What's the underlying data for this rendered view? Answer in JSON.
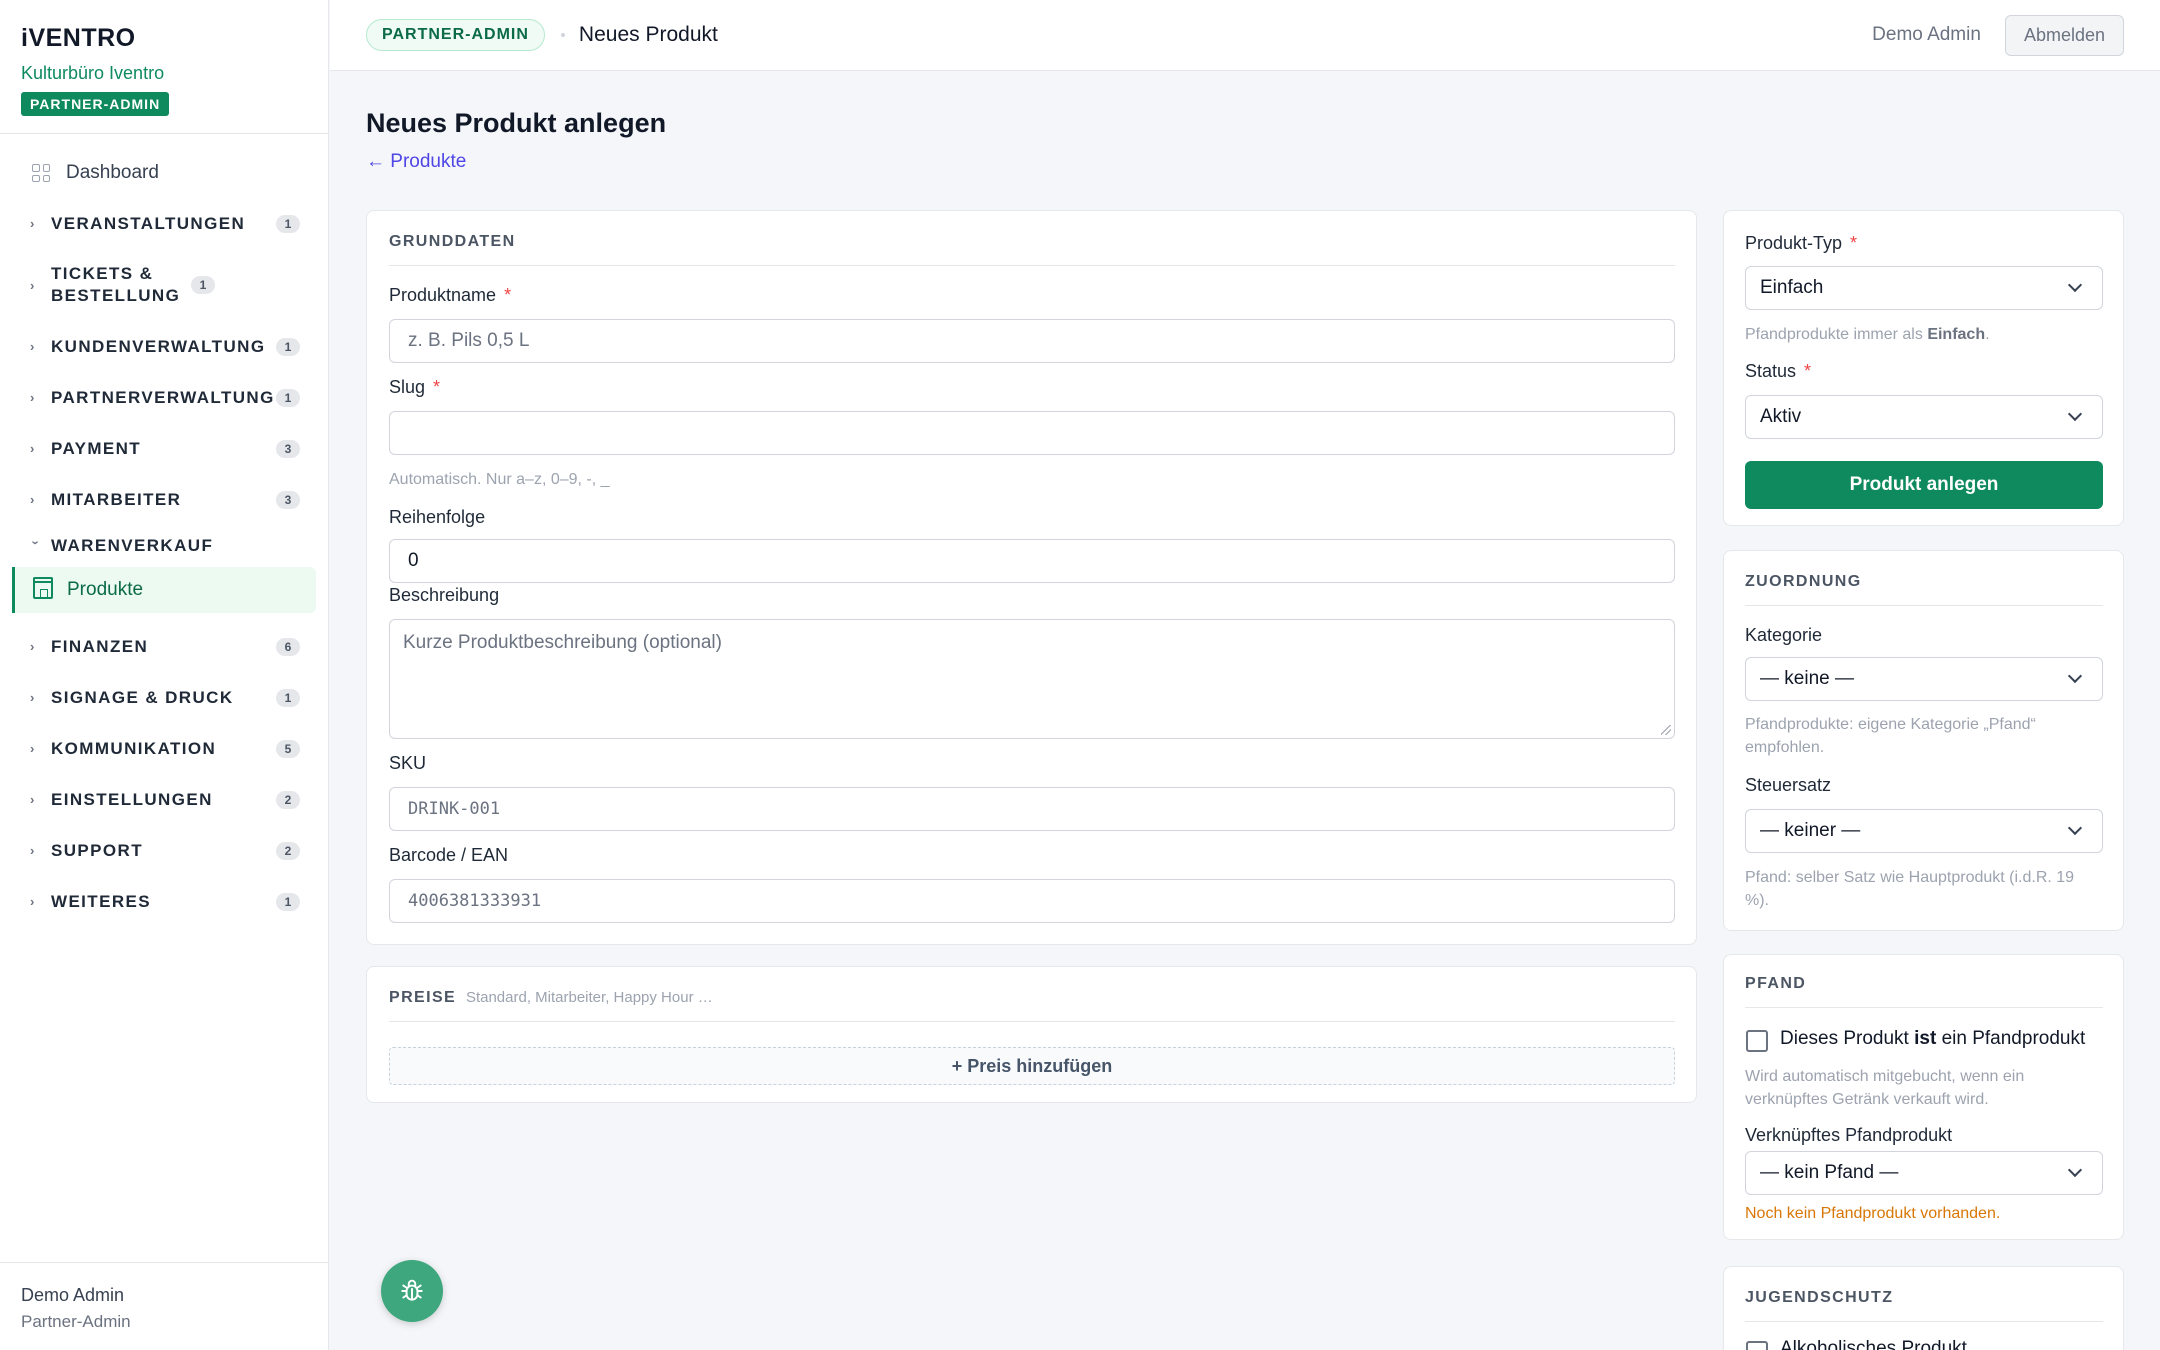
{
  "brand": {
    "logo": "iVENTRO",
    "org": "Kulturbüro Iventro",
    "role": "PARTNER-ADMIN"
  },
  "nav": {
    "dashboard": "Dashboard",
    "sections": [
      {
        "label": "VERANSTALTUNGEN",
        "count": "1"
      },
      {
        "label": "TICKETS & BESTELLUNG",
        "count": "1"
      },
      {
        "label": "KUNDENVERWALTUNG",
        "count": "1"
      },
      {
        "label": "PARTNERVERWALTUNG",
        "count": "1"
      },
      {
        "label": "PAYMENT",
        "count": "3"
      },
      {
        "label": "MITARBEITER",
        "count": "3"
      },
      {
        "label": "WARENVERKAUF",
        "count": ""
      },
      {
        "label": "FINANZEN",
        "count": "6"
      },
      {
        "label": "SIGNAGE & DRUCK",
        "count": "1"
      },
      {
        "label": "KOMMUNIKATION",
        "count": "5"
      },
      {
        "label": "EINSTELLUNGEN",
        "count": "2"
      },
      {
        "label": "SUPPORT",
        "count": "2"
      },
      {
        "label": "WEITERES",
        "count": "1"
      }
    ],
    "active_item": "Produkte"
  },
  "sidebar_footer": {
    "name": "Demo Admin",
    "role": "Partner-Admin"
  },
  "topbar": {
    "badge": "PARTNER-ADMIN",
    "title": "Neues Produkt",
    "user": "Demo Admin",
    "logout": "Abmelden"
  },
  "page": {
    "title": "Neues Produkt anlegen",
    "back": "← Produkte"
  },
  "grunddaten": {
    "title": "GRUNDDATEN",
    "name_label": "Produktname",
    "name_placeholder": "z. B. Pils 0,5 L",
    "slug_label": "Slug",
    "slug_value": "",
    "slug_hint": "Automatisch. Nur a–z, 0–9, -, _",
    "order_label": "Reihenfolge",
    "order_value": "0",
    "desc_label": "Beschreibung",
    "desc_placeholder": "Kurze Produktbeschreibung (optional)",
    "sku_label": "SKU",
    "sku_placeholder": "DRINK-001",
    "barcode_label": "Barcode / EAN",
    "barcode_placeholder": "4006381333931"
  },
  "preise": {
    "title": "PREISE",
    "subtitle": "Standard, Mitarbeiter, Happy Hour …",
    "add": "+ Preis hinzufügen"
  },
  "typ": {
    "type_label": "Produkt-Typ",
    "type_value": "Einfach",
    "type_hint_pre": "Pfandprodukte immer als ",
    "type_hint_bold": "Einfach",
    "type_hint_post": ".",
    "status_label": "Status",
    "status_value": "Aktiv",
    "submit": "Produkt anlegen"
  },
  "zuordnung": {
    "title": "ZUORDNUNG",
    "category_label": "Kategorie",
    "category_value": "— keine —",
    "category_hint": "Pfandprodukte: eigene Kategorie „Pfand“ empfohlen.",
    "tax_label": "Steuersatz",
    "tax_value": "— keiner —",
    "tax_hint": "Pfand: selber Satz wie Hauptprodukt (i.d.R. 19 %)."
  },
  "pfand": {
    "title": "PFAND",
    "checkbox_pre": "Dieses Produkt ",
    "checkbox_bold": "ist",
    "checkbox_post": " ein Pfandprodukt",
    "checkbox_hint": "Wird automatisch mitgebucht, wenn ein verknüpftes Getränk verkauft wird.",
    "linked_label": "Verknüpftes Pfandprodukt",
    "linked_value": "— kein Pfand —",
    "warning": "Noch kein Pfandprodukt vorhanden."
  },
  "jugendschutz": {
    "title": "JUGENDSCHUTZ",
    "checkbox": "Alkoholisches Produkt"
  }
}
